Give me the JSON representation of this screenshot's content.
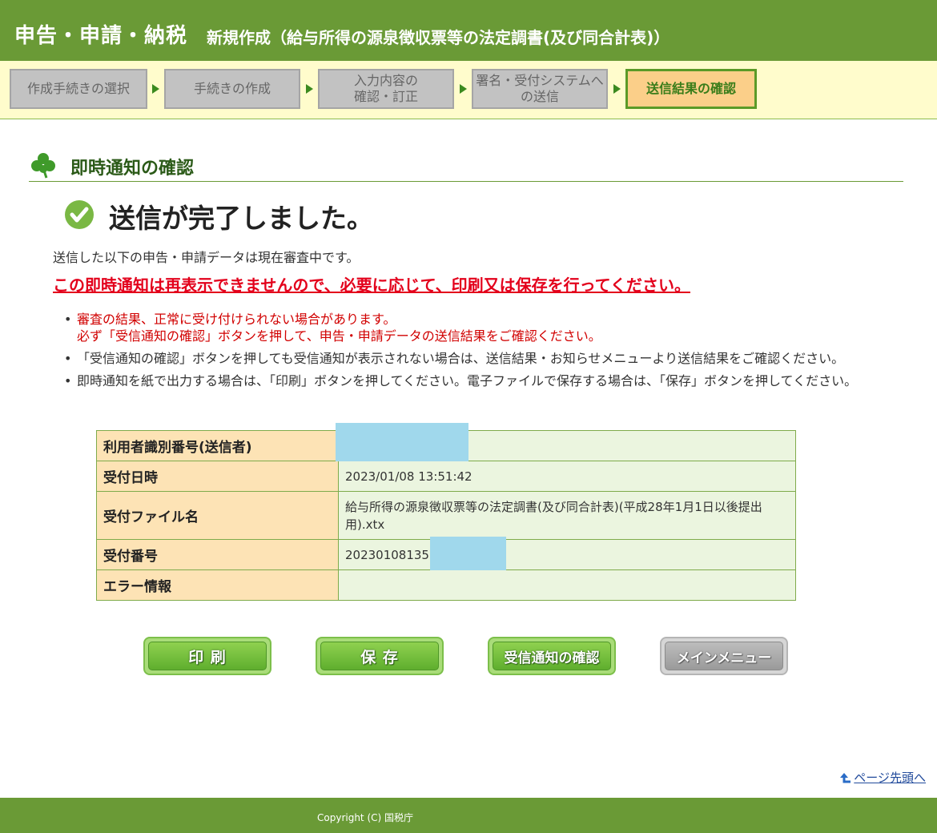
{
  "header": {
    "title": "申告・申請・納税",
    "subtitle": "新規作成（給与所得の源泉徴収票等の法定調書(及び同合計表)）"
  },
  "steps": [
    {
      "label": "作成手続きの選択",
      "active": false
    },
    {
      "label": "手続きの作成",
      "active": false
    },
    {
      "label": "入力内容の\n確認・訂正",
      "active": false
    },
    {
      "label": "署名・受付システムへ\nの送信",
      "active": false
    },
    {
      "label": "送信結果の確認",
      "active": true
    }
  ],
  "section": {
    "heading": "即時通知の確認"
  },
  "status": {
    "complete_message": "送信が完了しました。",
    "description": "送信した以下の申告・申請データは現在審査中です。",
    "warning": "この即時通知は再表示できませんので、必要に応じて、印刷又は保存を行ってください。"
  },
  "notes": [
    {
      "line1": "審査の結果、正常に受け付けられない場合があります。",
      "line2": "必ず「受信通知の確認」ボタンを押して、申告・申請データの送信結果をご確認ください。"
    },
    {
      "line1": "「受信通知の確認」ボタンを押しても受信通知が表示されない場合は、送信結果・お知らせメニューより送信結果をご確認ください。"
    },
    {
      "line1": "即時通知を紙で出力する場合は、「印刷」ボタンを押してください。電子ファイルで保存する場合は、「保存」ボタンを押してください。"
    }
  ],
  "table": {
    "rows": [
      {
        "label": "利用者識別番号(送信者)",
        "value": ""
      },
      {
        "label": "受付日時",
        "value": "2023/01/08 13:51:42"
      },
      {
        "label": "受付ファイル名",
        "value": "給与所得の源泉徴収票等の法定調書(及び同合計表)(平成28年1月1日以後提出用).xtx"
      },
      {
        "label": "受付番号",
        "value": "202301081351"
      },
      {
        "label": "エラー情報",
        "value": ""
      }
    ]
  },
  "buttons": {
    "print": "印 刷",
    "save": "保 存",
    "receipt": "受信通知の確認",
    "main_menu": "メインメニュー"
  },
  "links": {
    "page_top": "ページ先頭へ"
  },
  "footer": {
    "copyright": "Copyright (C) 国税庁"
  },
  "colors": {
    "brand_green": "#6a9a36",
    "warning_red": "#e3001b",
    "active_step": "#fbcf89",
    "redaction": "#a0d8ec"
  }
}
